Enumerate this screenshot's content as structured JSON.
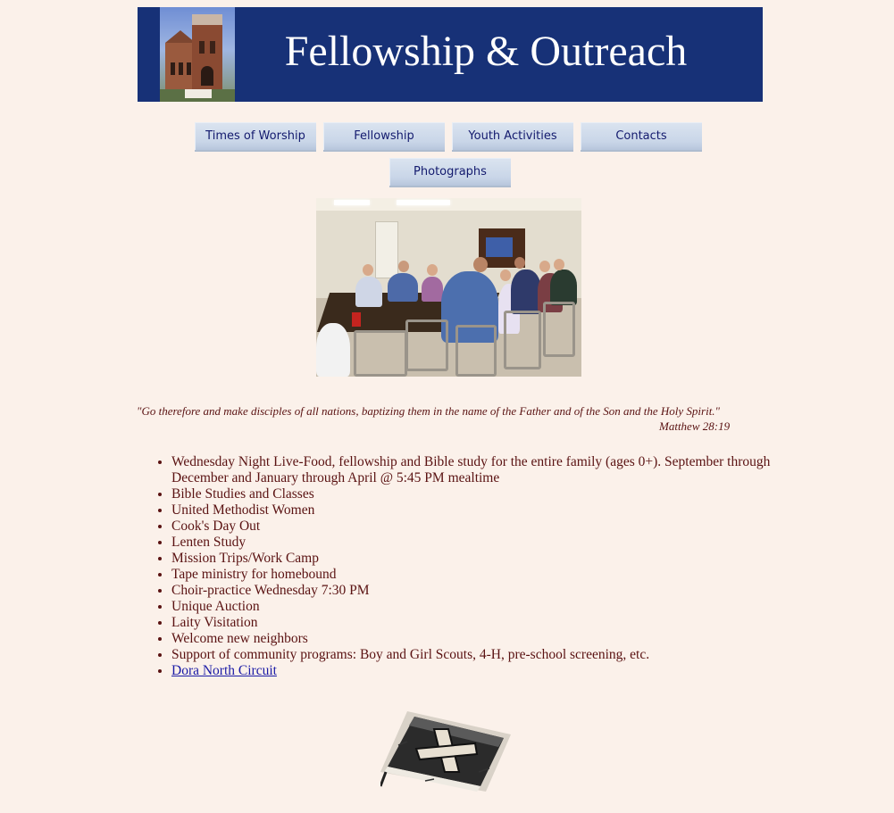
{
  "header": {
    "title": "Fellowship & Outreach"
  },
  "nav": {
    "items": [
      {
        "label": "Times of Worship"
      },
      {
        "label": "Fellowship"
      },
      {
        "label": "Youth Activities"
      },
      {
        "label": "Contacts"
      },
      {
        "label": "Photographs"
      }
    ]
  },
  "verse": {
    "text": "\"Go therefore and make disciples of all nations, baptizing them in the name of the Father and of the Son and the Holy Spirit.\"",
    "reference": "Matthew 28:19"
  },
  "activities": [
    "Wednesday Night Live-Food, fellowship and Bible study for the entire family (ages 0+).  September through December and January through April @ 5:45 PM mealtime",
    "Bible Studies and Classes",
    "United Methodist Women",
    "Cook's Day Out",
    "Lenten Study",
    "Mission Trips/Work Camp",
    "Tape ministry for homebound",
    "Choir-practice Wednesday 7:30 PM",
    "Unique Auction",
    "Laity Visitation",
    "Welcome new neighbors",
    "Support of community programs: Boy and Girl Scouts, 4-H, pre-school screening, etc."
  ],
  "link": {
    "label": "Dora North Circuit"
  },
  "colors": {
    "banner": "#173177",
    "page_background": "#fbf1ea",
    "body_text": "#5a1212",
    "link": "#1a1aa6",
    "nav_text": "#131a6e"
  },
  "icons": {
    "banner_image": "church-building-photo",
    "fellowship_image": "fellowship-group-photo",
    "footer_image": "bible-with-cross-icon"
  }
}
